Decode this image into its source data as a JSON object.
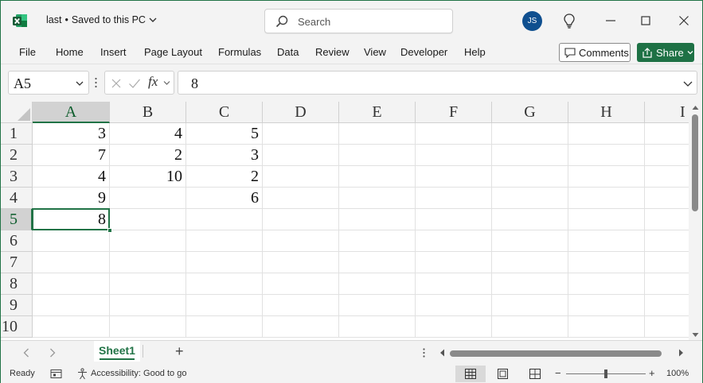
{
  "window": {
    "file_name": "last",
    "save_status": "Saved to this PC",
    "search_placeholder": "Search",
    "user_initials": "JS"
  },
  "menu": {
    "items": [
      "File",
      "Home",
      "Insert",
      "Page Layout",
      "Formulas",
      "Data",
      "Review",
      "View",
      "Developer",
      "Help"
    ],
    "comments_label": "Comments",
    "share_label": "Share"
  },
  "formula_bar": {
    "name_box": "A5",
    "fx_label": "fx",
    "value": "8"
  },
  "sheet": {
    "columns": [
      "A",
      "B",
      "C",
      "D",
      "E",
      "F",
      "G",
      "H",
      "I"
    ],
    "rows": [
      "1",
      "2",
      "3",
      "4",
      "5",
      "6",
      "7",
      "8",
      "9",
      "10"
    ],
    "active_cell": "A5",
    "cells": [
      [
        "3",
        "4",
        "5"
      ],
      [
        "7",
        "2",
        "3"
      ],
      [
        "4",
        "10",
        "2"
      ],
      [
        "9",
        "",
        "6"
      ],
      [
        "8",
        "",
        ""
      ]
    ]
  },
  "tabs": {
    "sheet_name": "Sheet1",
    "add_label": "+"
  },
  "status": {
    "ready": "Ready",
    "accessibility": "Accessibility: Good to go",
    "zoom": "100%",
    "zoom_minus": "−",
    "zoom_plus": "+"
  },
  "colors": {
    "accent": "#217346",
    "share_bg": "#1e7145",
    "avatar_bg": "#0f4f8f"
  }
}
